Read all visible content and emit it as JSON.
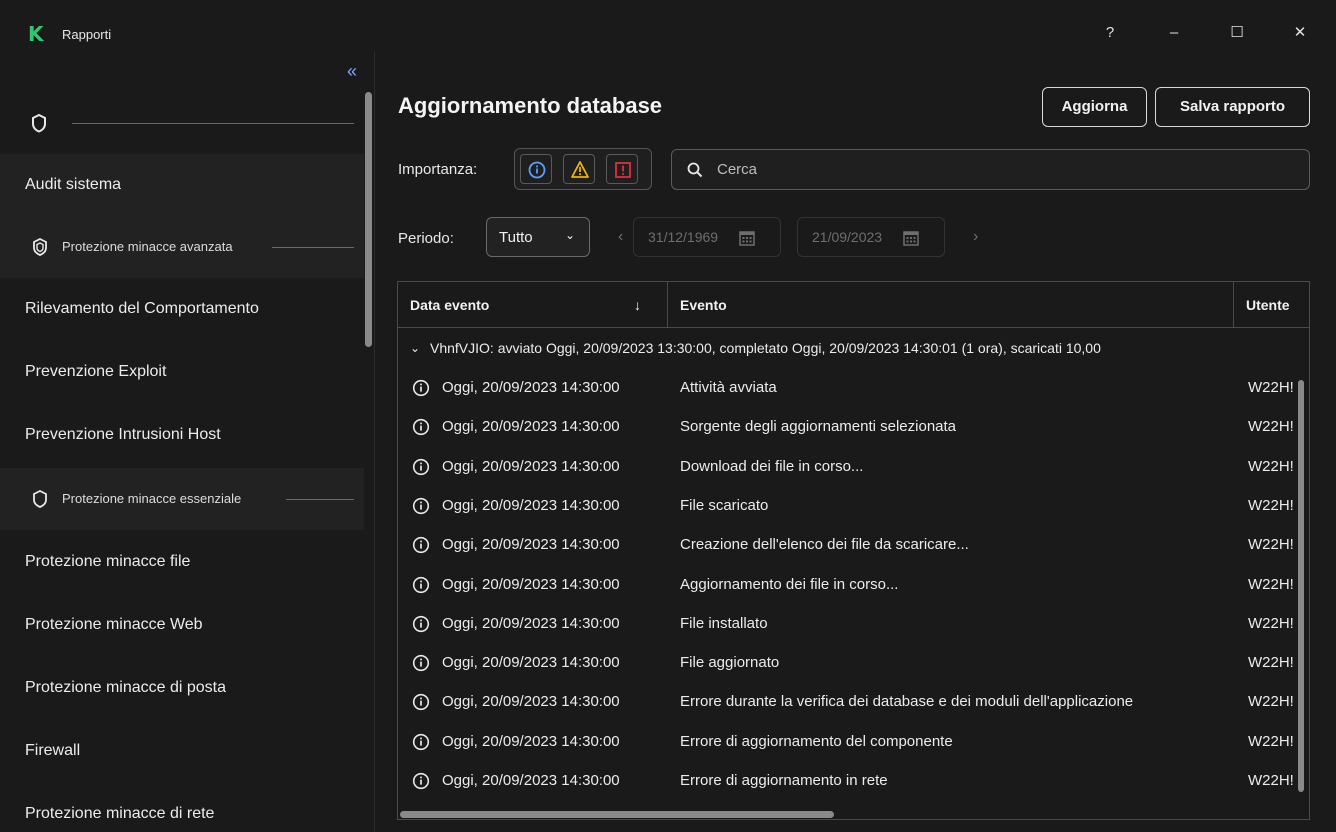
{
  "window": {
    "title": "Rapporti",
    "logo_letter": "K",
    "controls": {
      "help": "?",
      "minimize": "–",
      "maximize": "☐",
      "close": "✕"
    }
  },
  "sidebar": {
    "collapse_icon": "double-chevron-left-icon",
    "items": [
      {
        "type": "item",
        "label": "Audit sistema"
      },
      {
        "type": "group",
        "label": "Protezione minacce avanzata"
      },
      {
        "type": "item",
        "label": "Rilevamento del Comportamento"
      },
      {
        "type": "item",
        "label": "Prevenzione Exploit"
      },
      {
        "type": "item",
        "label": "Prevenzione Intrusioni Host"
      },
      {
        "type": "group",
        "label": "Protezione minacce essenziale"
      },
      {
        "type": "item",
        "label": "Protezione minacce file"
      },
      {
        "type": "item",
        "label": "Protezione minacce Web"
      },
      {
        "type": "item",
        "label": "Protezione minacce di posta"
      },
      {
        "type": "item",
        "label": "Firewall"
      },
      {
        "type": "item",
        "label": "Protezione minacce di rete"
      }
    ]
  },
  "main": {
    "title": "Aggiornamento database",
    "buttons": {
      "refresh": "Aggiorna",
      "save": "Salva rapporto"
    },
    "importance_label": "Importanza:",
    "importance_colors": {
      "info": "#5aa0ff",
      "warning": "#f0b400",
      "critical": "#e0303a"
    },
    "search_placeholder": "Cerca",
    "period_label": "Periodo:",
    "period_value": "Tutto",
    "date_from": "31/12/1969",
    "date_to": "21/09/2023",
    "table": {
      "columns": {
        "date": "Data evento",
        "event": "Evento",
        "user": "Utente"
      },
      "sort_indicator": "↓",
      "group_row": "VhnfVJIO: avviato Oggi, 20/09/2023 13:30:00, completato Oggi, 20/09/2023 14:30:01 (1 ora), scaricati 10,00",
      "rows": [
        {
          "date": "Oggi, 20/09/2023 14:30:00",
          "event": "Attività avviata",
          "user": "W22H!"
        },
        {
          "date": "Oggi, 20/09/2023 14:30:00",
          "event": "Sorgente degli aggiornamenti selezionata",
          "user": "W22H!"
        },
        {
          "date": "Oggi, 20/09/2023 14:30:00",
          "event": "Download dei file in corso...",
          "user": "W22H!"
        },
        {
          "date": "Oggi, 20/09/2023 14:30:00",
          "event": "File scaricato",
          "user": "W22H!"
        },
        {
          "date": "Oggi, 20/09/2023 14:30:00",
          "event": "Creazione dell'elenco dei file da scaricare...",
          "user": "W22H!"
        },
        {
          "date": "Oggi, 20/09/2023 14:30:00",
          "event": "Aggiornamento dei file in corso...",
          "user": "W22H!"
        },
        {
          "date": "Oggi, 20/09/2023 14:30:00",
          "event": "File installato",
          "user": "W22H!"
        },
        {
          "date": "Oggi, 20/09/2023 14:30:00",
          "event": "File aggiornato",
          "user": "W22H!"
        },
        {
          "date": "Oggi, 20/09/2023 14:30:00",
          "event": "Errore durante la verifica dei database e dei moduli dell'applicazione",
          "user": "W22H!"
        },
        {
          "date": "Oggi, 20/09/2023 14:30:00",
          "event": "Errore di aggiornamento del componente",
          "user": "W22H!"
        },
        {
          "date": "Oggi, 20/09/2023 14:30:00",
          "event": "Errore di aggiornamento in rete",
          "user": "W22H!"
        }
      ]
    }
  }
}
